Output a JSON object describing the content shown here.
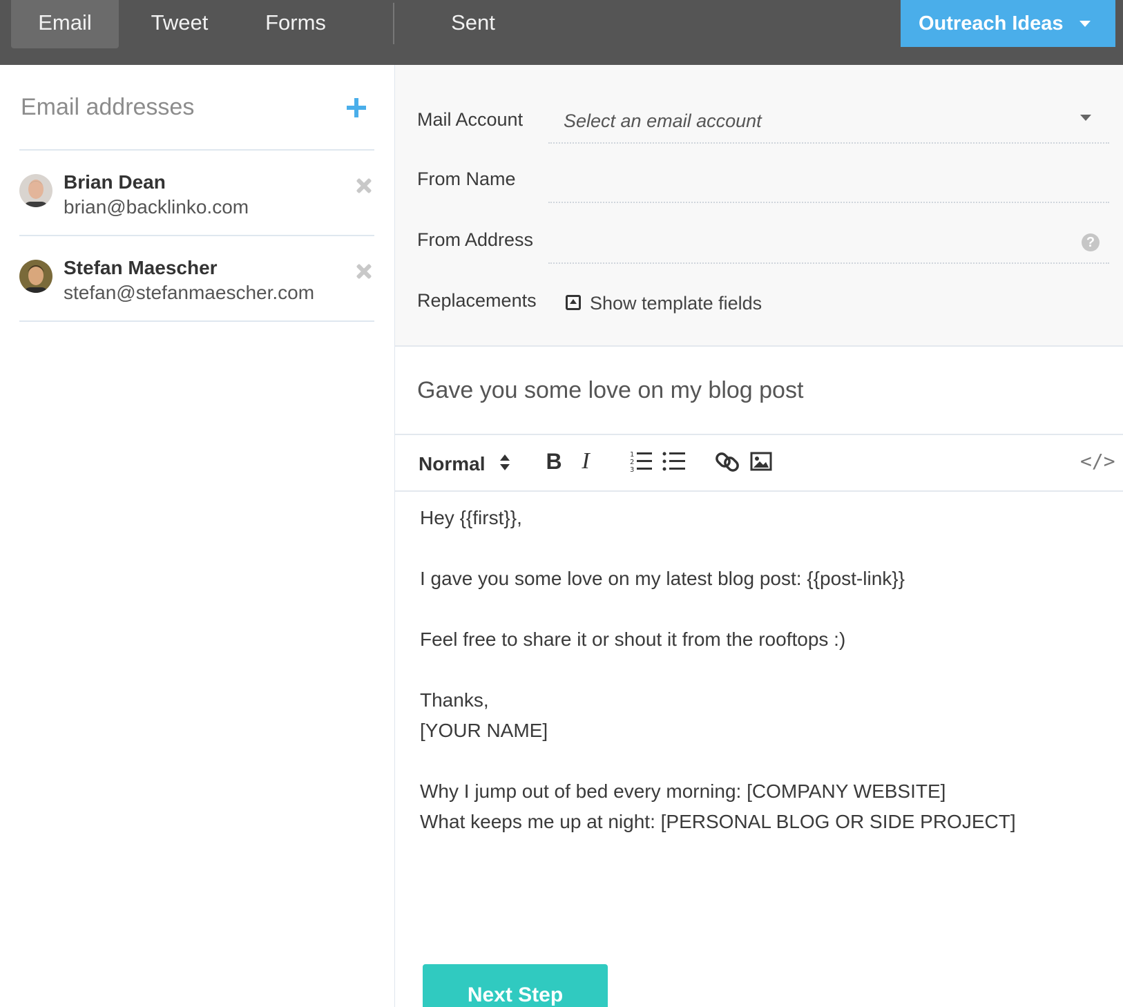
{
  "nav": {
    "tabs": [
      {
        "label": "Email",
        "active": true
      },
      {
        "label": "Tweet",
        "active": false
      },
      {
        "label": "Forms",
        "active": false
      },
      {
        "label": "Sent",
        "active": false
      }
    ],
    "outreach_label": "Outreach Ideas"
  },
  "sidebar": {
    "title": "Email addresses",
    "contacts": [
      {
        "name": "Brian Dean",
        "email": "brian@backlinko.com"
      },
      {
        "name": "Stefan Maescher",
        "email": "stefan@stefanmaescher.com"
      }
    ]
  },
  "settings": {
    "mail_account_label": "Mail Account",
    "mail_account_placeholder": "Select an email account",
    "from_name_label": "From Name",
    "from_name_value": "",
    "from_address_label": "From Address",
    "from_address_value": "",
    "help_icon": "?",
    "replacements_label": "Replacements",
    "show_template_fields": "Show template fields"
  },
  "subject": "Gave you some love on my blog post",
  "toolbar": {
    "format_label": "Normal",
    "bold_label": "B",
    "italic_label": "I",
    "code_label": "</>"
  },
  "body": {
    "greeting": "Hey {{first}},",
    "line1": "I gave you some love on my latest blog post: {{post-link}}",
    "line2": "Feel free to share it or shout it from the rooftops :)",
    "signoff": "Thanks,",
    "name": "[YOUR NAME]",
    "ps1": "Why I jump out of bed every morning: [COMPANY WEBSITE]",
    "ps2": "What keeps me up at night: [PERSONAL BLOG OR SIDE PROJECT]"
  },
  "next_step_label": "Next Step",
  "colors": {
    "topbar": "#555555",
    "accent_blue": "#4aaeea",
    "next_button": "#30cac0"
  }
}
